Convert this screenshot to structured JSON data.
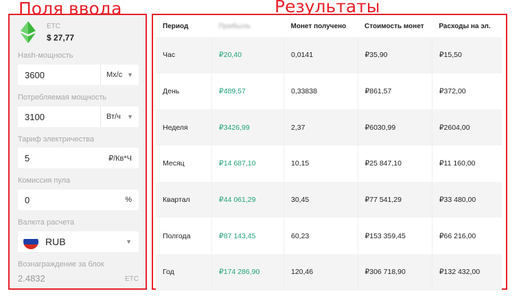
{
  "annotations": {
    "left": "Поля ввода",
    "right": "Результаты"
  },
  "coin": {
    "name": "ETC",
    "price": "$ 27,77",
    "icon": "ethereum-classic-icon",
    "icon_color": "#3ab83a"
  },
  "inputs": {
    "hashrate": {
      "label": "Hash-мощность",
      "value": "3600",
      "unit": "Мх/с"
    },
    "power": {
      "label": "Потребляемая мощность",
      "value": "3100",
      "unit": "Вт/ч"
    },
    "tariff": {
      "label": "Тариф электричества",
      "value": "5",
      "unit": "₽/Кв*Ч"
    },
    "pool_fee": {
      "label": "Комиссия пула",
      "value": "0",
      "unit": "%"
    },
    "currency": {
      "label": "Валюта расчета",
      "value": "RUB",
      "icon": "russia-flag-icon"
    },
    "reward": {
      "label": "Вознаграждение за блок",
      "value": "2.4832",
      "unit": "ETC"
    }
  },
  "results": {
    "headers": [
      "Период",
      "Прибыль",
      "Монет получено",
      "Стоимость монет",
      "Расходы на эл."
    ],
    "rows": [
      {
        "period": "Час",
        "profit": "₽20,40",
        "coins": "0,0141",
        "cost": "₽35,90",
        "expenses": "₽15,50"
      },
      {
        "period": "День",
        "profit": "₽489,57",
        "coins": "0,33838",
        "cost": "₽861,57",
        "expenses": "₽372,00"
      },
      {
        "period": "Неделя",
        "profit": "₽3426,99",
        "coins": "2,37",
        "cost": "₽6030,99",
        "expenses": "₽2604,00"
      },
      {
        "period": "Месяц",
        "profit": "₽14 687,10",
        "coins": "10,15",
        "cost": "₽25 847,10",
        "expenses": "₽11 160,00"
      },
      {
        "period": "Квартал",
        "profit": "₽44 061,29",
        "coins": "30,45",
        "cost": "₽77 541,29",
        "expenses": "₽33 480,00"
      },
      {
        "period": "Полгода",
        "profit": "₽87 143,45",
        "coins": "60,23",
        "cost": "₽153 359,45",
        "expenses": "₽66 216,00"
      },
      {
        "period": "Год",
        "profit": "₽174 286,90",
        "coins": "120,46",
        "cost": "₽306 718,90",
        "expenses": "₽132 432,00"
      }
    ]
  },
  "colors": {
    "annotation": "#e8202a",
    "profit": "#1fa27a",
    "panel_bg": "#f2f2f2"
  }
}
